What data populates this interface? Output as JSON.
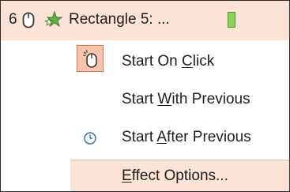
{
  "animation_item": {
    "order": "6",
    "name": "Rectangle 5: ...",
    "trigger_icon": "mouse-icon",
    "effect_icon": "star-icon",
    "timing_color": "#8bd15a"
  },
  "menu": {
    "items": [
      {
        "label_pre": "Start On ",
        "label_key": "C",
        "label_post": "lick",
        "icon": "mouse-click-icon",
        "active": true
      },
      {
        "label_pre": "Start ",
        "label_key": "W",
        "label_post": "ith Previous",
        "icon": "",
        "active": false
      },
      {
        "label_pre": "Start ",
        "label_key": "A",
        "label_post": "fter Previous",
        "icon": "clock-icon",
        "active": false
      },
      {
        "label_pre": "",
        "label_key": "E",
        "label_post": "ffect Options...",
        "icon": "",
        "active": false,
        "highlighted": true
      }
    ]
  },
  "colors": {
    "highlight": "#fbe3d8",
    "icon_box": "#f7c4ad",
    "icon_border": "#e2714a"
  }
}
